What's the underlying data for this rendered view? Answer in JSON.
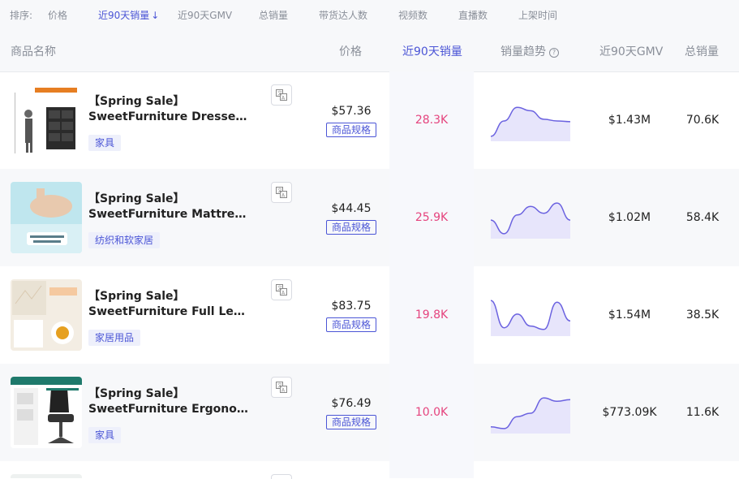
{
  "sort_bar": {
    "label": "排序:",
    "options": [
      "价格",
      "近90天销量",
      "近90天GMV",
      "总销量",
      "带货达人数",
      "视频数",
      "直播数",
      "上架时间"
    ],
    "active_arrow": "↓"
  },
  "table_header": {
    "name": "商品名称",
    "price": "价格",
    "sales90": "近90天销量",
    "trend": "销量趋势",
    "gmv90": "近90天GMV",
    "total": "总销量"
  },
  "colors": {
    "accent": "#4b55d6",
    "sales_highlight": "#e5447e",
    "trend_line": "#6b62e0",
    "trend_fill": "#e7e5fb"
  },
  "products": [
    {
      "title_line1": "【Spring Sale】",
      "title_line2": "SweetFurniture Dresser,...",
      "category": "家具",
      "price": "$57.36",
      "spec_label": "商品规格",
      "sales90": "28.3K",
      "gmv90": "$1.43M",
      "total": "70.6K",
      "trend": [
        0.95,
        0.5,
        0.1,
        0.2,
        0.45,
        0.5,
        0.52
      ]
    },
    {
      "title_line1": "【Spring Sale】",
      "title_line2": "SweetFurniture Mattress...",
      "category": "纺织和软家居",
      "price": "$44.45",
      "spec_label": "商品规格",
      "sales90": "25.9K",
      "gmv90": "$1.02M",
      "total": "58.4K",
      "trend": [
        0.55,
        0.95,
        0.4,
        0.15,
        0.35,
        0.05,
        0.55
      ]
    },
    {
      "title_line1": "【Spring Sale】",
      "title_line2": "SweetFurniture Full Length...",
      "category": "家居用品",
      "price": "$83.75",
      "spec_label": "商品规格",
      "sales90": "19.8K",
      "gmv90": "$1.54M",
      "total": "38.5K",
      "trend": [
        0.05,
        0.85,
        0.45,
        0.8,
        0.9,
        0.1,
        0.65
      ]
    },
    {
      "title_line1": "【Spring Sale】",
      "title_line2": "SweetFurniture Ergonomic...",
      "category": "家具",
      "price": "$76.49",
      "spec_label": "商品规格",
      "sales90": "10.0K",
      "gmv90": "$773.09K",
      "total": "11.6K",
      "trend": [
        0.9,
        0.95,
        0.6,
        0.5,
        0.05,
        0.15,
        0.1
      ]
    }
  ]
}
